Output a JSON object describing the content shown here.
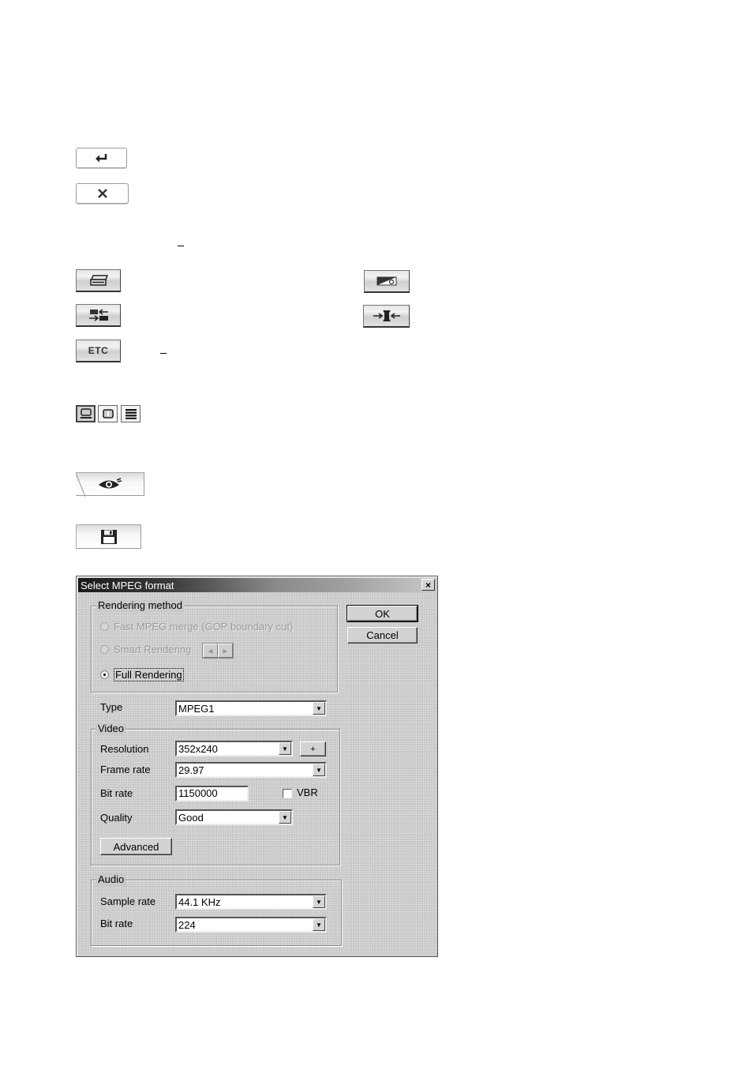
{
  "page": {
    "icons": {
      "enter": "enter-arrow-icon",
      "close": "x-close-icon",
      "clip_box": "clip-box-icon",
      "image_edit": "image-edit-icon",
      "swap": "swap-arrows-icon",
      "squeeze": "squeeze-arrows-icon",
      "view_storyboard": "storyboard-view-icon",
      "view_single": "single-view-icon",
      "view_list": "list-view-icon",
      "preview": "eye-icon",
      "save": "floppy-disk-icon"
    },
    "etc_label": "ETC"
  },
  "dialog": {
    "title": "Select MPEG format",
    "close_glyph": "×",
    "ok_label": "OK",
    "cancel_label": "Cancel",
    "rendering": {
      "legend": "Rendering method",
      "options": [
        {
          "label": "Fast MPEG merge (GOP boundary cut)",
          "enabled": false,
          "selected": false
        },
        {
          "label": "Smart Rendering",
          "enabled": false,
          "selected": false
        },
        {
          "label": "Full Rendering",
          "enabled": true,
          "selected": true
        }
      ],
      "spin_left": "◀",
      "spin_right": "▶"
    },
    "type": {
      "label": "Type",
      "value": "MPEG1"
    },
    "video": {
      "legend": "Video",
      "resolution": {
        "label": "Resolution",
        "value": "352x240",
        "plus_label": "+"
      },
      "frame_rate": {
        "label": "Frame rate",
        "value": "29.97"
      },
      "bit_rate": {
        "label": "Bit rate",
        "value": "1150000"
      },
      "vbr": {
        "label": "VBR",
        "checked": false
      },
      "quality": {
        "label": "Quality",
        "value": "Good"
      },
      "advanced_label": "Advanced"
    },
    "audio": {
      "legend": "Audio",
      "sample_rate": {
        "label": "Sample rate",
        "value": "44.1 KHz"
      },
      "bit_rate": {
        "label": "Bit rate",
        "value": "224"
      }
    },
    "dropdown_arrow": "▼"
  }
}
